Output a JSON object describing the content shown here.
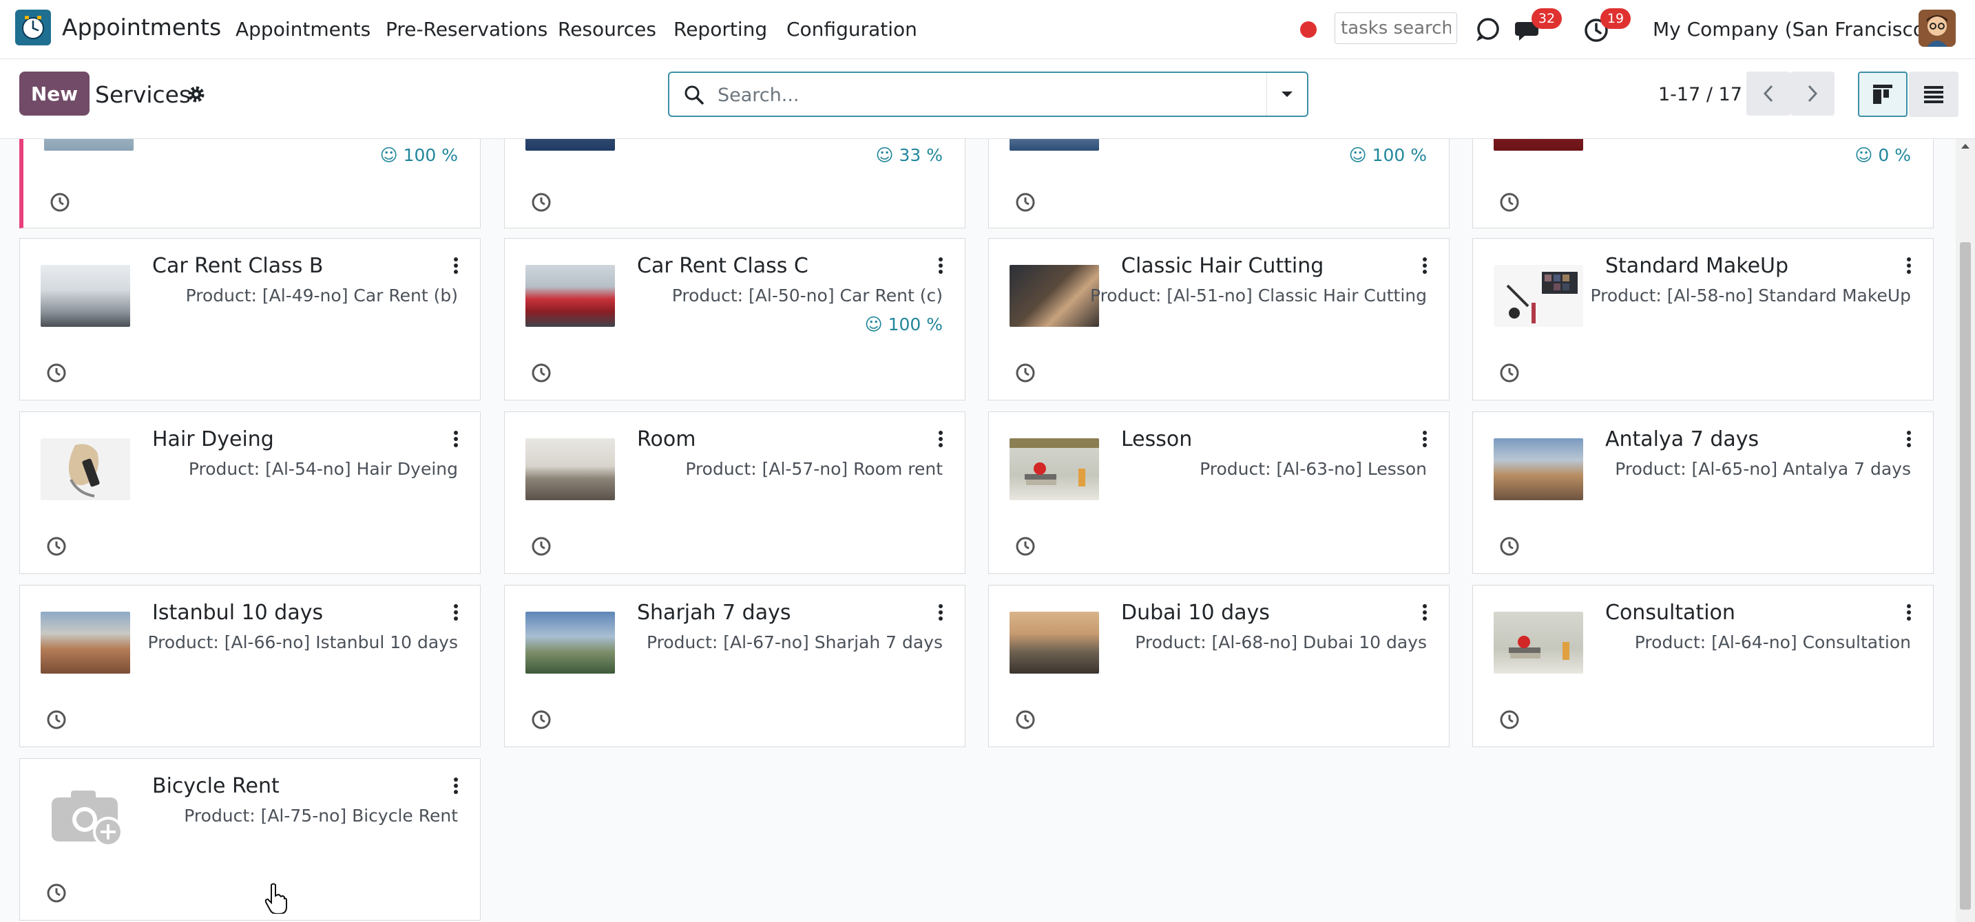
{
  "navbar": {
    "app_name": "Appointments",
    "menu": [
      "Appointments",
      "Pre-Reservations",
      "Resources",
      "Reporting",
      "Configuration"
    ],
    "tasks_search_placeholder": "tasks search",
    "messages_badge": "32",
    "activities_badge": "19",
    "company": "My Company (San Francisco)"
  },
  "control": {
    "new_label": "New",
    "breadcrumb": "Services",
    "search_placeholder": "Search...",
    "pager": "1-17 / 17"
  },
  "top_cards": [
    {
      "rating": "100 %"
    },
    {
      "rating": "33 %"
    },
    {
      "rating": "100 %"
    },
    {
      "rating": "0 %"
    }
  ],
  "cards": [
    {
      "name": "Car Rent Class B",
      "product": "Product: [Al-49-no] Car Rent (b)",
      "rating": ""
    },
    {
      "name": "Car Rent Class C",
      "product": "Product: [Al-50-no] Car Rent (c)",
      "rating": "100 %"
    },
    {
      "name": "Classic Hair Cutting",
      "product": "Product: [Al-51-no] Classic Hair Cutting",
      "rating": ""
    },
    {
      "name": "Standard MakeUp",
      "product": "Product: [Al-58-no] Standard MakeUp",
      "rating": ""
    },
    {
      "name": "Hair Dyeing",
      "product": "Product: [Al-54-no] Hair Dyeing",
      "rating": ""
    },
    {
      "name": "Room",
      "product": "Product: [Al-57-no] Room rent",
      "rating": ""
    },
    {
      "name": "Lesson",
      "product": "Product: [Al-63-no] Lesson",
      "rating": ""
    },
    {
      "name": "Antalya 7 days",
      "product": "Product: [Al-65-no] Antalya 7 days",
      "rating": ""
    },
    {
      "name": "Istanbul 10 days",
      "product": "Product: [Al-66-no] Istanbul 10 days",
      "rating": ""
    },
    {
      "name": "Sharjah 7 days",
      "product": "Product: [Al-67-no] Sharjah 7 days",
      "rating": ""
    },
    {
      "name": "Dubai 10 days",
      "product": "Product: [Al-68-no] Dubai 10 days",
      "rating": ""
    },
    {
      "name": "Consultation",
      "product": "Product: [Al-64-no] Consultation",
      "rating": ""
    },
    {
      "name": "Bicycle Rent",
      "product": "Product: [Al-75-no] Bicycle Rent",
      "rating": ""
    }
  ],
  "colors": {
    "brand": "#714b67",
    "accent_teal": "#21879b",
    "badge_red": "#e03131",
    "stripe_pink": "#e8407a"
  }
}
